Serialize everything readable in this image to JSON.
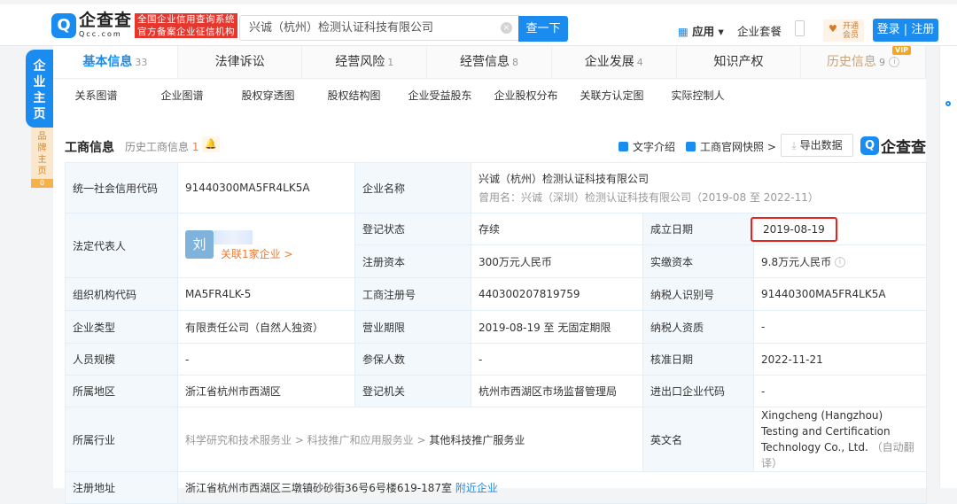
{
  "header": {
    "logo_text": "企查查",
    "logo_domain": "Qcc.com",
    "badge_line1": "全国企业信用查询系统",
    "badge_line2": "官方备案企业征信机构",
    "search_value": "兴诚（杭州）检测认证科技有限公司",
    "search_button": "查一下",
    "apps": "应用",
    "packages": "企业套餐",
    "vip_line1": "开通",
    "vip_line2": "会员",
    "login": "登录 | 注册"
  },
  "side": {
    "main_tab": "企业主页",
    "brand_tab": "品牌主页",
    "brand_count": "0"
  },
  "tabs": [
    {
      "label": "基本信息",
      "count": "33"
    },
    {
      "label": "法律诉讼",
      "count": ""
    },
    {
      "label": "经营风险",
      "count": "1"
    },
    {
      "label": "经营信息",
      "count": "8"
    },
    {
      "label": "企业发展",
      "count": "4"
    },
    {
      "label": "知识产权",
      "count": ""
    },
    {
      "label": "历史信息",
      "count": "9",
      "badge": "VIP"
    }
  ],
  "subnav": [
    "关系图谱",
    "企业图谱",
    "股权穿透图",
    "股权结构图",
    "企业受益股东",
    "企业股权分布",
    "关联方认定图",
    "实际控制人"
  ],
  "section": {
    "title": "工商信息",
    "history": "历史工商信息",
    "history_count": "1",
    "text_intro": "文字介绍",
    "snapshot": "工商官网快照 >",
    "export": "导出数据",
    "logo": "企查查"
  },
  "info": {
    "credit_code_label": "统一社会信用代码",
    "credit_code": "91440300MA5FR4LK5A",
    "name_label": "企业名称",
    "name": "兴诚（杭州）检测认证科技有限公司",
    "former_name": "曾用名：兴诚（深圳）检测认证科技有限公司（2019-08 至 2022-11）",
    "legal_rep_label": "法定代表人",
    "legal_rep_avatar": "刘",
    "legal_rep_related": "关联1家企业 >",
    "status_label": "登记状态",
    "status": "存续",
    "founded_label": "成立日期",
    "founded": "2019-08-19",
    "reg_capital_label": "注册资本",
    "reg_capital": "300万元人民币",
    "paid_capital_label": "实缴资本",
    "paid_capital": "9.8万元人民币",
    "org_code_label": "组织机构代码",
    "org_code": "MA5FR4LK-5",
    "biz_reg_label": "工商注册号",
    "biz_reg": "440300207819759",
    "taxpayer_id_label": "纳税人识别号",
    "taxpayer_id": "91440300MA5FR4LK5A",
    "type_label": "企业类型",
    "type": "有限责任公司（自然人独资）",
    "term_label": "营业期限",
    "term": "2019-08-19 至 无固定期限",
    "taxpayer_q_label": "纳税人资质",
    "taxpayer_q": "-",
    "staff_label": "人员规模",
    "staff": "-",
    "insured_label": "参保人数",
    "insured": "-",
    "approved_label": "核准日期",
    "approved": "2022-11-21",
    "region_label": "所属地区",
    "region": "浙江省杭州市西湖区",
    "authority_label": "登记机关",
    "authority": "杭州市西湖区市场监督管理局",
    "ie_code_label": "进出口企业代码",
    "ie_code": "-",
    "industry_label": "所属行业",
    "industry_1": "科学研究和技术服务业 > 科技推广和应用服务业 > ",
    "industry_2": "其他科技推广服务业",
    "english_label": "英文名",
    "english": "Xingcheng (Hangzhou) Testing and Certification Technology Co., Ltd.",
    "english_note": "（自动翻译）",
    "address_label": "注册地址",
    "address": "浙江省杭州市西湖区三墩镇砂砂街36号6号楼619-187室",
    "nearby": "附近企业"
  }
}
